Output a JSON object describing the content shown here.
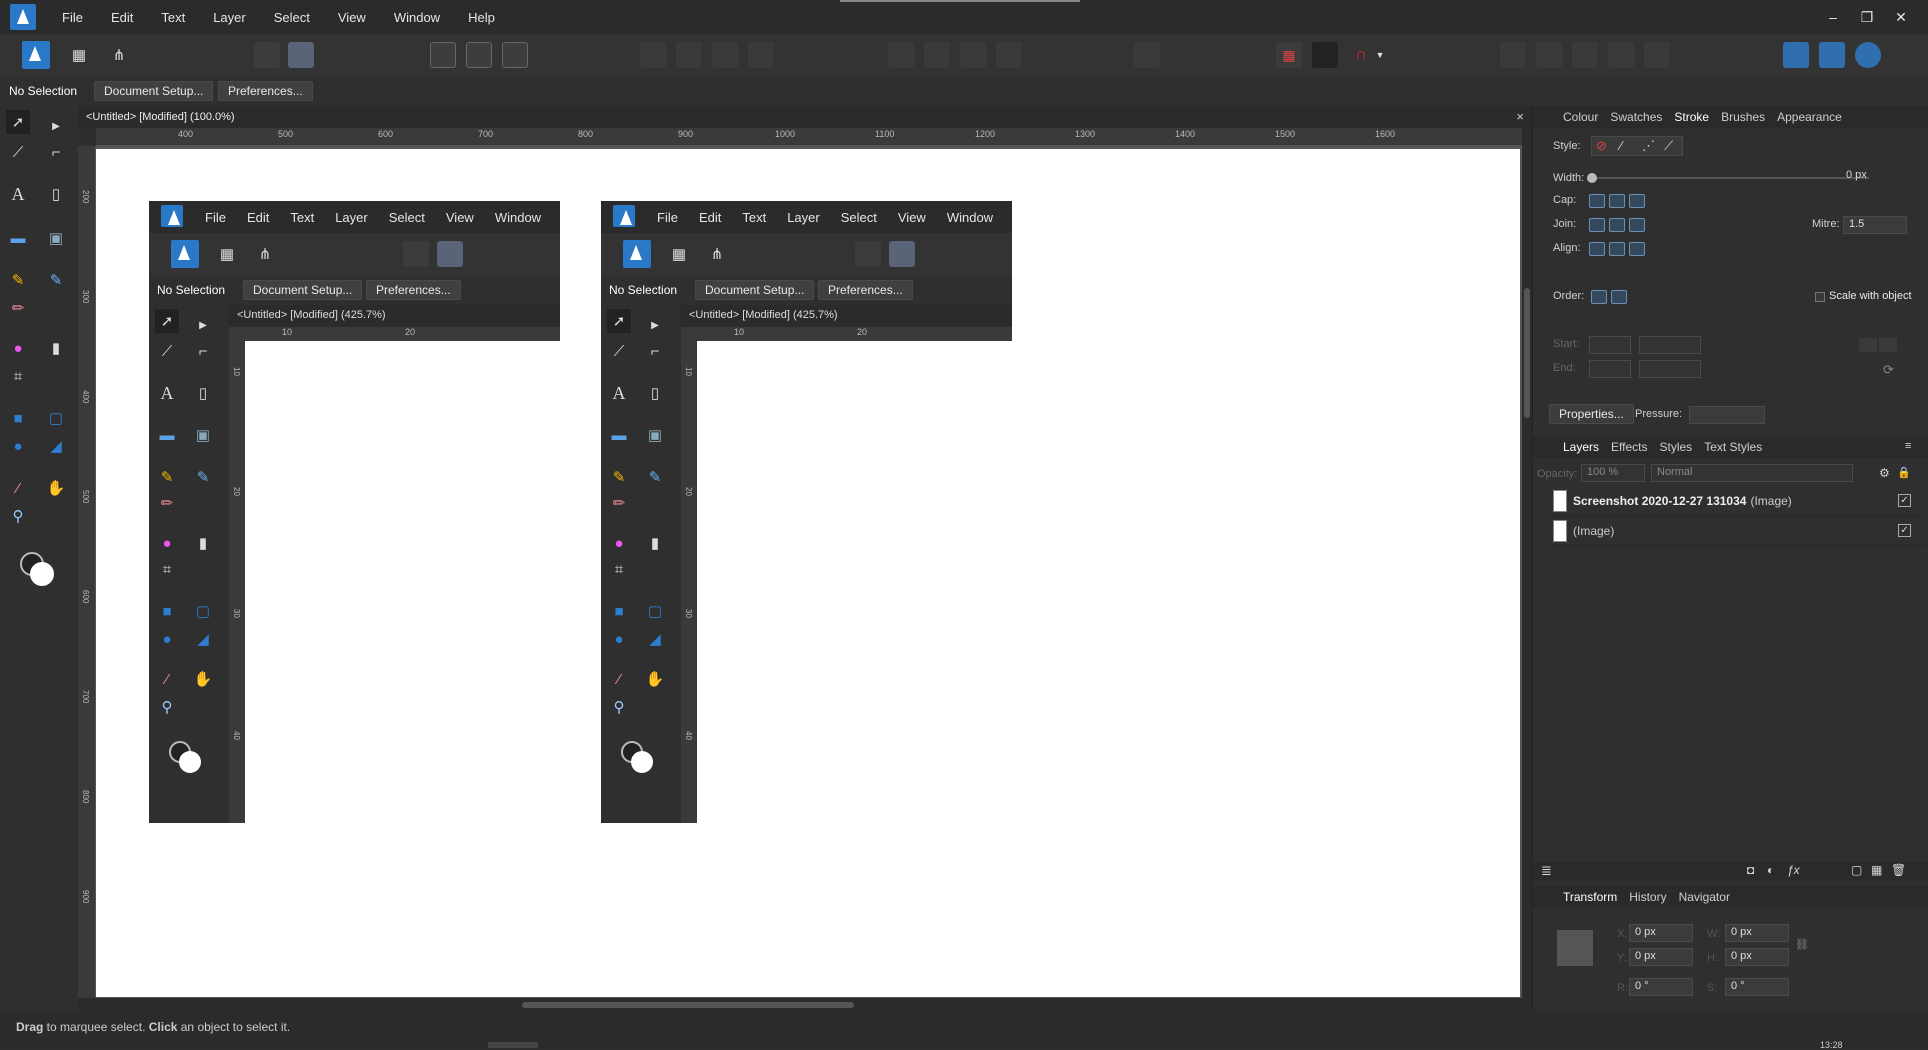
{
  "menubar": {
    "items": [
      "File",
      "Edit",
      "Text",
      "Layer",
      "Select",
      "View",
      "Window",
      "Help"
    ],
    "controls": [
      "–",
      "❐",
      "✕"
    ]
  },
  "context": {
    "selection": "No Selection",
    "document_setup": "Document Setup...",
    "preferences": "Preferences..."
  },
  "doc_tab": {
    "title": "<Untitled> [Modified] (100.0%)",
    "close": "×"
  },
  "ruler_h": [
    "400",
    "500",
    "600",
    "700",
    "800",
    "900",
    "1000",
    "1100",
    "1200",
    "1300",
    "1400",
    "1500",
    "1600"
  ],
  "ruler_v": [
    "200",
    "300",
    "400",
    "500",
    "600",
    "700",
    "800",
    "900"
  ],
  "status": {
    "drag": "Drag",
    "t1": " to marquee select. ",
    "click": "Click",
    "t2": " an object to select it."
  },
  "panel_tabs": {
    "colour": "Colour",
    "swatches": "Swatches",
    "stroke": "Stroke",
    "brushes": "Brushes",
    "appearance": "Appearance"
  },
  "stroke": {
    "style": "Style:",
    "width": "Width:",
    "width_value": "0 px",
    "cap": "Cap:",
    "join": "Join:",
    "align": "Align:",
    "mitre": "Mitre:",
    "mitre_value": "1.5",
    "order": "Order:",
    "scale": "Scale with object",
    "start": "Start:",
    "end": "End:",
    "properties": "Properties...",
    "pressure": "Pressure:"
  },
  "layers_tabs": {
    "layers": "Layers",
    "effects": "Effects",
    "styles": "Styles",
    "text_styles": "Text Styles"
  },
  "layers": {
    "opacity_label": "Opacity:",
    "opacity": "100 %",
    "blend": "Normal",
    "items": [
      {
        "name": "Screenshot 2020-12-27 131034",
        "kind": "(Image)"
      },
      {
        "name": "",
        "kind": "(Image)"
      }
    ]
  },
  "transform_tabs": {
    "transform": "Transform",
    "history": "History",
    "navigator": "Navigator"
  },
  "transform": {
    "x": "X:",
    "y": "Y:",
    "w": "W:",
    "h": "H:",
    "r": "R:",
    "s": "S:",
    "x_val": "0 px",
    "y_val": "0 px",
    "w_val": "0 px",
    "h_val": "0 px",
    "r_val": "0 °",
    "s_val": "0 °"
  },
  "embedded": {
    "menu": [
      "File",
      "Edit",
      "Text",
      "Layer",
      "Select",
      "View",
      "Window"
    ],
    "selection": "No Selection",
    "document_setup": "Document Setup...",
    "preferences": "Preferences...",
    "tab": "<Untitled> [Modified] (425.7%)",
    "r10": "10",
    "r20": "20",
    "rv10": "10",
    "rv20": "20",
    "rv30": "30",
    "rv40": "40"
  },
  "clock": "13:28"
}
